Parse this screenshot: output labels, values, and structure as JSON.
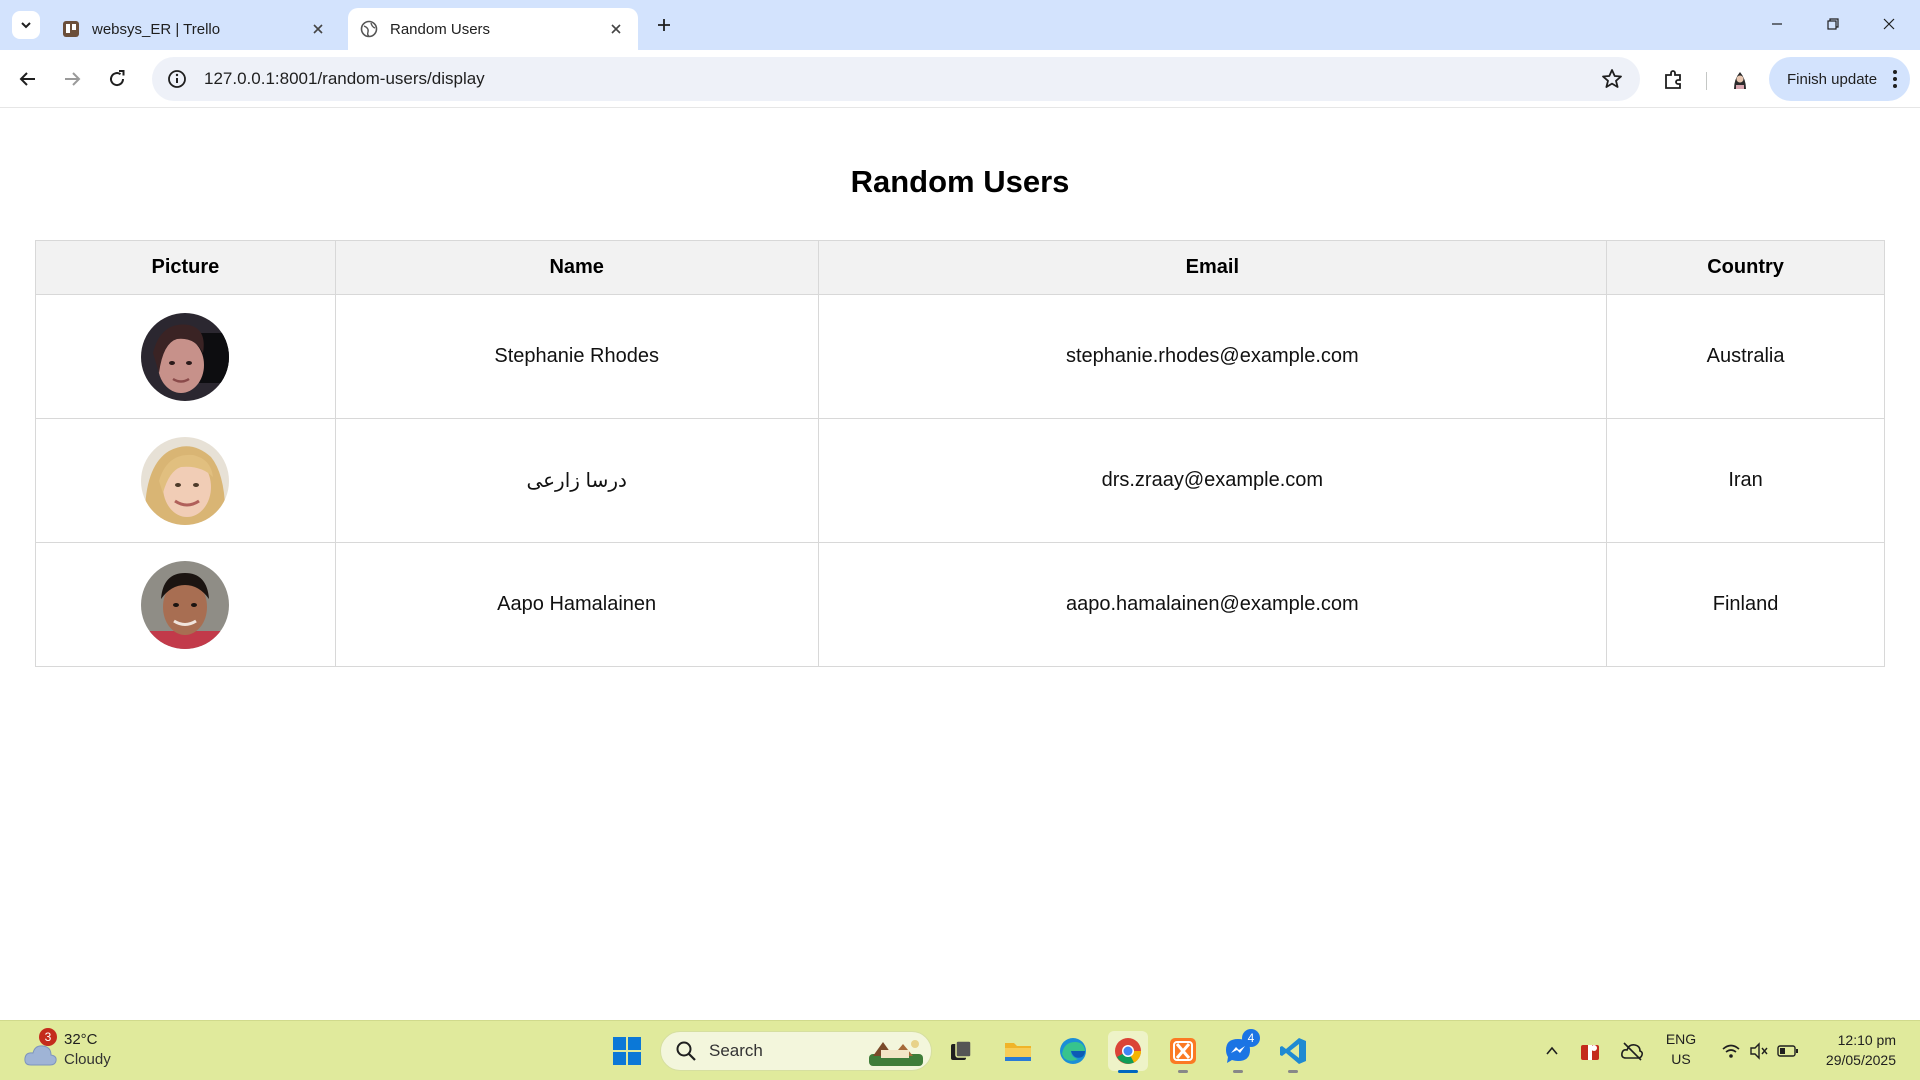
{
  "browser": {
    "tabs": [
      {
        "title": "websys_ER | Trello",
        "active": false,
        "favicon": "trello-icon"
      },
      {
        "title": "Random Users",
        "active": true,
        "favicon": "globe-icon"
      }
    ],
    "address_bar": {
      "url": "127.0.0.1:8001/random-users/display"
    },
    "finish_update_label": "Finish update"
  },
  "page": {
    "title": "Random Users",
    "table": {
      "headers": [
        "Picture",
        "Name",
        "Email",
        "Country"
      ],
      "rows": [
        {
          "name": "Stephanie Rhodes",
          "email": "stephanie.rhodes@example.com",
          "country": "Australia"
        },
        {
          "name": "درسا زارعی",
          "email": "drs.zraay@example.com",
          "country": "Iran"
        },
        {
          "name": "Aapo Hamalainen",
          "email": "aapo.hamalainen@example.com",
          "country": "Finland"
        }
      ]
    }
  },
  "taskbar": {
    "weather": {
      "temp": "32°C",
      "desc": "Cloudy",
      "badge": "3"
    },
    "search_label": "Search",
    "messenger_badge": "4",
    "lang_top": "ENG",
    "lang_bottom": "US",
    "time": "12:10 pm",
    "date": "29/05/2025"
  },
  "colors": {
    "tabstrip": "#d3e3fd",
    "taskbar": "#e0ea9c",
    "table_header_bg": "#f2f2f2",
    "accent": "#0067c0"
  }
}
